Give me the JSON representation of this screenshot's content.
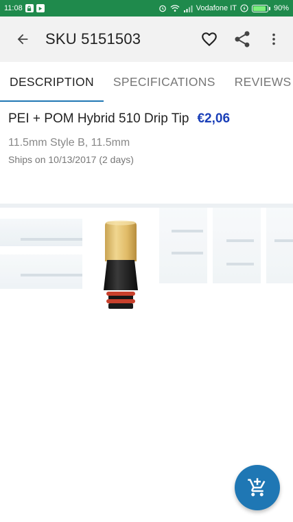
{
  "status_bar": {
    "time": "11:08",
    "carrier": "Vodafone IT",
    "battery": "90%",
    "battery_level": 0.9
  },
  "app_bar": {
    "title": "SKU 5151503",
    "back_icon": "arrow-left-icon",
    "favorite_icon": "heart-outline-icon",
    "share_icon": "share-icon",
    "more_icon": "more-vert-icon"
  },
  "tabs": [
    {
      "label": "DESCRIPTION",
      "active": true
    },
    {
      "label": "SPECIFICATIONS",
      "active": false
    },
    {
      "label": "REVIEWS (",
      "active": false
    }
  ],
  "product": {
    "title": "PEI + POM Hybrid 510 Drip Tip",
    "price": "€2,06",
    "variant": "11.5mm Style B, 11.5mm",
    "ships": "Ships on 10/13/2017 (2 days)"
  },
  "fab": {
    "icon": "add-shopping-cart-icon"
  },
  "colors": {
    "status_bar": "#1f8a4c",
    "app_bar": "#f2f2f2",
    "accent": "#1f77b4",
    "price": "#1a3fb8"
  }
}
